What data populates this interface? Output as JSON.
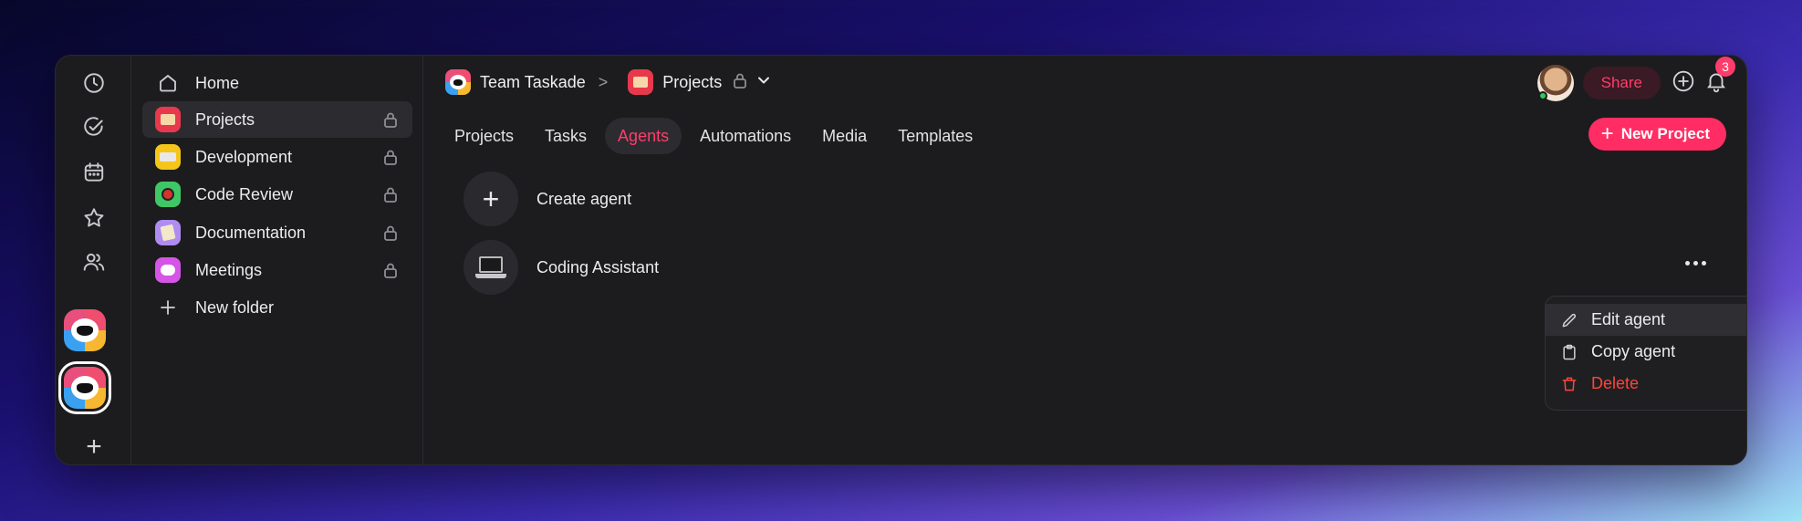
{
  "rail": {
    "icons": [
      "clock-icon",
      "check-circle-icon",
      "calendar-icon",
      "star-icon",
      "people-icon"
    ],
    "add_label": "+"
  },
  "sidebar": {
    "items": [
      {
        "label": "Home",
        "icon": "home-icon"
      },
      {
        "label": "Projects",
        "icon": "folder-icon",
        "locked": true
      },
      {
        "label": "Development",
        "icon": "keyboard-icon",
        "locked": true
      },
      {
        "label": "Code Review",
        "icon": "ladybug-icon",
        "locked": true
      },
      {
        "label": "Documentation",
        "icon": "memo-icon",
        "locked": true
      },
      {
        "label": "Meetings",
        "icon": "speech-bubble-icon",
        "locked": true
      },
      {
        "label": "New folder",
        "icon": "plus-icon"
      }
    ]
  },
  "breadcrumb": {
    "workspace": "Team Taskade",
    "sep": ">",
    "project": "Projects"
  },
  "tabs": [
    {
      "label": "Projects"
    },
    {
      "label": "Tasks"
    },
    {
      "label": "Agents",
      "active": true
    },
    {
      "label": "Automations"
    },
    {
      "label": "Media"
    },
    {
      "label": "Templates"
    }
  ],
  "header": {
    "share_label": "Share",
    "notification_count": "3",
    "new_project_label": "New Project",
    "new_project_plus": "+"
  },
  "agents": {
    "create_label": "Create agent",
    "create_symbol": "+",
    "items": [
      {
        "name": "Coding Assistant",
        "icon": "laptop-icon"
      }
    ]
  },
  "context_menu": {
    "items": [
      {
        "label": "Edit agent",
        "icon": "pencil-icon"
      },
      {
        "label": "Copy agent",
        "icon": "clipboard-icon"
      },
      {
        "label": "Delete",
        "icon": "trash-icon"
      }
    ]
  },
  "colors": {
    "accent": "#ff2d63",
    "danger": "#ff453a",
    "background": "#1c1c1e"
  }
}
